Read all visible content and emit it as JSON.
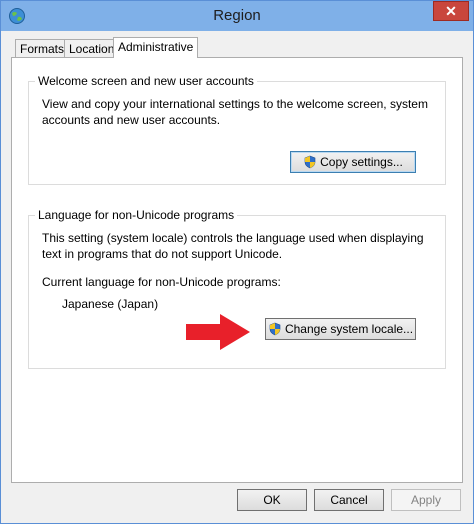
{
  "window": {
    "title": "Region",
    "close_label": "✕"
  },
  "tabs": [
    {
      "label": "Formats"
    },
    {
      "label": "Location"
    },
    {
      "label": "Administrative"
    }
  ],
  "welcome_group": {
    "title": "Welcome screen and new user accounts",
    "description_line1": "View and copy your international settings to the welcome screen, system",
    "description_line2": "accounts and new user accounts.",
    "copy_button": "Copy settings..."
  },
  "unicode_group": {
    "title": "Language for non-Unicode programs",
    "description_line1": "This setting (system locale) controls the language used when displaying",
    "description_line2": "text in programs that do not support Unicode.",
    "current_label": "Current language for non-Unicode programs:",
    "current_value": "Japanese (Japan)",
    "change_button": "Change system locale..."
  },
  "footer": {
    "ok_label": "OK",
    "cancel_label": "Cancel",
    "apply_label": "Apply"
  },
  "colors": {
    "arrow": "#e8202a",
    "titlebar": "#7fb0e8",
    "close": "#c9463d"
  }
}
